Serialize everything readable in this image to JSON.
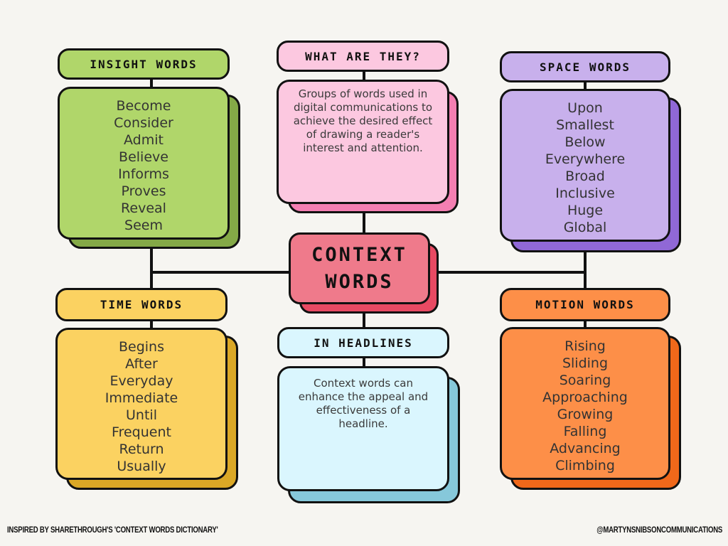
{
  "center": {
    "title_line1": "CONTEXT",
    "title_line2": "WORDS",
    "color": "#ef7a8b",
    "shadow_color": "#e84a63"
  },
  "insight": {
    "title": "INSIGHT WORDS",
    "color": "#b0d66a",
    "shadow_color": "#84a947",
    "words": [
      "Become",
      "Consider",
      "Admit",
      "Believe",
      "Informs",
      "Proves",
      "Reveal",
      "Seem"
    ]
  },
  "what": {
    "title": "WHAT ARE THEY?",
    "color": "#fcc8e0",
    "shadow_color": "#f47fb2",
    "text": "Groups of words used in digital communications to achieve the desired effect of drawing a reader's interest and attention."
  },
  "space": {
    "title": "SPACE WORDS",
    "color": "#c8b0ec",
    "shadow_color": "#9068d6",
    "words": [
      "Upon",
      "Smallest",
      "Below",
      "Everywhere",
      "Broad",
      "Inclusive",
      "Huge",
      "Global"
    ]
  },
  "time": {
    "title": "TIME WORDS",
    "color": "#fbd261",
    "shadow_color": "#dba826",
    "words": [
      "Begins",
      "After",
      "Everyday",
      "Immediate",
      "Until",
      "Frequent",
      "Return",
      "Usually"
    ]
  },
  "headlines": {
    "title": "IN HEADLINES",
    "color": "#daf6fe",
    "shadow_color": "#86c8da",
    "text": "Context words can enhance the appeal and effectiveness of a headline."
  },
  "motion": {
    "title": "MOTION WORDS",
    "color": "#fd8f48",
    "shadow_color": "#f0681a",
    "words": [
      "Rising",
      "Sliding",
      "Soaring",
      "Approaching",
      "Growing",
      "Falling",
      "Advancing",
      "Climbing"
    ]
  },
  "footer": {
    "left": "Inspired by Sharethrough's 'Context Words Dictionary'",
    "right": "@martynsnibsoncommunications"
  }
}
